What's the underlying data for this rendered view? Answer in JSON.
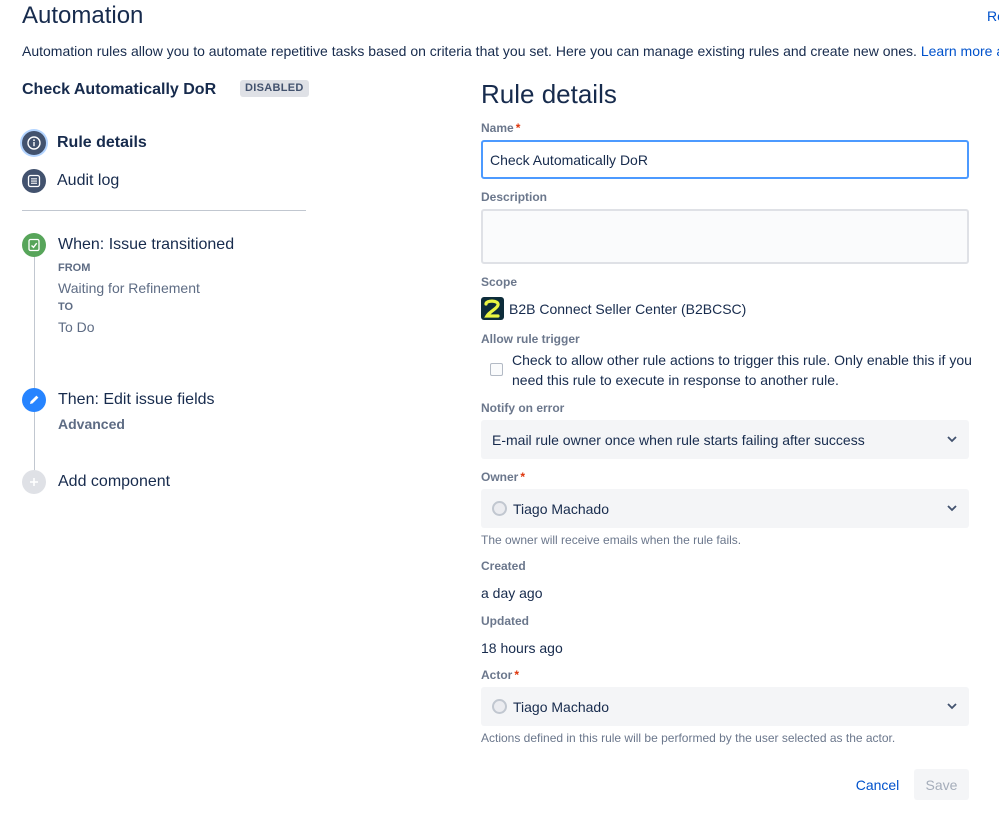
{
  "header": {
    "title": "Automation",
    "top_right_link": "Re",
    "intro_text": "Automation rules allow you to automate repetitive tasks based on criteria that you set. Here you can manage existing rules and create new ones. ",
    "learn_more": "Learn more abou"
  },
  "sidebar": {
    "rule_name": "Check Automatically DoR",
    "status_badge": "DISABLED",
    "nav": [
      {
        "label": "Rule details",
        "icon": "info-icon",
        "active": true
      },
      {
        "label": "Audit log",
        "icon": "list-icon",
        "active": false
      }
    ],
    "trigger": {
      "title": "When: Issue transitioned",
      "from_label": "FROM",
      "from_value": "Waiting for Refinement",
      "to_label": "TO",
      "to_value": "To Do",
      "icon": "transition-icon",
      "color": "#57a55a"
    },
    "action": {
      "title": "Then: Edit issue fields",
      "subtitle": "Advanced",
      "icon": "pencil-icon",
      "color": "#2684ff"
    },
    "add_component": {
      "label": "Add component",
      "icon": "plus-icon"
    }
  },
  "form": {
    "title": "Rule details",
    "name_label": "Name",
    "name_value": "Check Automatically DoR",
    "description_label": "Description",
    "description_value": "",
    "scope_label": "Scope",
    "scope_value": "B2B Connect Seller Center (B2BCSC)",
    "allow_trigger_label": "Allow rule trigger",
    "allow_trigger_text": "Check to allow other rule actions to trigger this rule. Only enable this if you need this rule to execute in response to another rule.",
    "allow_trigger_checked": false,
    "notify_label": "Notify on error",
    "notify_value": "E-mail rule owner once when rule starts failing after success",
    "owner_label": "Owner",
    "owner_value": "Tiago Machado",
    "owner_helper": "The owner will receive emails when the rule fails.",
    "created_label": "Created",
    "created_value": "a day ago",
    "updated_label": "Updated",
    "updated_value": "18 hours ago",
    "actor_label": "Actor",
    "actor_value": "Tiago Machado",
    "actor_helper": "Actions defined in this rule will be performed by the user selected as the actor.",
    "required_mark": "*"
  },
  "buttons": {
    "cancel": "Cancel",
    "save": "Save"
  },
  "colors": {
    "accent": "#0052cc",
    "focus": "#4c9aff",
    "required": "#de350b"
  }
}
